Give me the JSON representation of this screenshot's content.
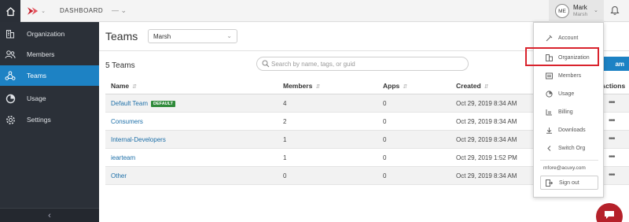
{
  "topbar": {
    "breadcrumb": "DASHBOARD",
    "breadcrumb2": "— ⌄",
    "user": {
      "initials": "ME",
      "name": "Mark",
      "org": "Marsh"
    }
  },
  "sidebar": {
    "items": [
      {
        "label": "Organization",
        "icon": "building-icon"
      },
      {
        "label": "Members",
        "icon": "members-icon"
      },
      {
        "label": "Teams",
        "icon": "teams-icon"
      },
      {
        "label": "Usage",
        "icon": "pie-chart-icon"
      },
      {
        "label": "Settings",
        "icon": "gear-icon"
      }
    ],
    "active": "Teams"
  },
  "main": {
    "title": "Teams",
    "team_select": {
      "value": "Marsh"
    },
    "count_label": "5 Teams",
    "search": {
      "placeholder": "Search by name, tags, or guid"
    },
    "create_label": "am",
    "table": {
      "columns": [
        "Name",
        "Members",
        "Apps",
        "Created",
        "Actions"
      ],
      "rows": [
        {
          "name": "Default Team",
          "badge": "DEFAULT",
          "members": "4",
          "apps": "0",
          "created": "Oct 29, 2019 8:34 AM"
        },
        {
          "name": "Consumers",
          "badge": "",
          "members": "2",
          "apps": "0",
          "created": "Oct 29, 2019 8:34 AM"
        },
        {
          "name": "Internal-Developers",
          "badge": "",
          "members": "1",
          "apps": "0",
          "created": "Oct 29, 2019 8:34 AM"
        },
        {
          "name": "iearteam",
          "badge": "",
          "members": "1",
          "apps": "0",
          "created": "Oct 29, 2019 1:52 PM"
        },
        {
          "name": "Other",
          "badge": "",
          "members": "0",
          "apps": "0",
          "created": "Oct 29, 2019 8:34 AM"
        }
      ]
    }
  },
  "user_menu": {
    "items": [
      {
        "label": "Account",
        "icon": "account-icon"
      },
      {
        "label": "Organization",
        "icon": "organization-icon"
      },
      {
        "label": "Members",
        "icon": "members-icon"
      },
      {
        "label": "Usage",
        "icon": "usage-icon"
      },
      {
        "label": "Billing",
        "icon": "billing-icon"
      },
      {
        "label": "Downloads",
        "icon": "download-icon"
      },
      {
        "label": "Switch Org",
        "icon": "switch-icon"
      }
    ],
    "email": "mfore@acuxy.com",
    "signout_label": "Sign out"
  },
  "colors": {
    "sidebar_bg": "#2b3038",
    "accent": "#1d82c4",
    "badge_green": "#2f8a3a",
    "highlight_red": "#d9232d",
    "chat_red": "#b5212a"
  }
}
